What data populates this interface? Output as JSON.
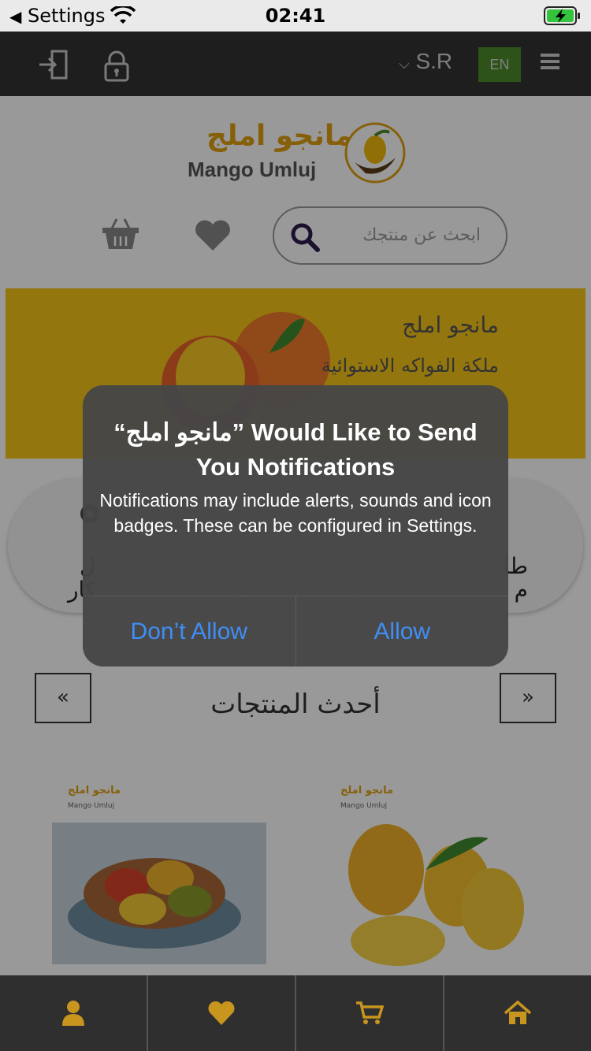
{
  "status_bar": {
    "back_label": "Settings",
    "time": "02:41"
  },
  "top_nav": {
    "currency": "S.R",
    "language": "EN",
    "accent_color": "#4c8a2a"
  },
  "logo": {
    "arabic": "مانجو املج",
    "english": "Mango Umluj"
  },
  "search": {
    "placeholder": "ابحث عن منتجك"
  },
  "banner": {
    "line1": "مانجو املج",
    "line2": "ملكة الفواكه الاستوائية"
  },
  "categories": [
    {
      "label": "ل\nكار"
    },
    {
      "label": "طا\nم"
    }
  ],
  "section": {
    "title": "أحدث المنتجات",
    "prev_label": "«",
    "next_label": "»"
  },
  "products": [
    {
      "logo_ar": "مانجو املج",
      "logo_en": "Mango Umluj"
    },
    {
      "logo_ar": "مانجو املج",
      "logo_en": "Mango Umluj"
    }
  ],
  "alert": {
    "title": "“مانجو املج” Would Like to Send You Notifications",
    "message": "Notifications may include alerts, sounds and icon badges. These can be configured in Settings.",
    "deny_label": "Don’t Allow",
    "allow_label": "Allow"
  },
  "tab_bar": {
    "icons": [
      "user-icon",
      "heart-icon",
      "cart-icon",
      "home-icon"
    ],
    "icon_color": "#c8951e"
  }
}
